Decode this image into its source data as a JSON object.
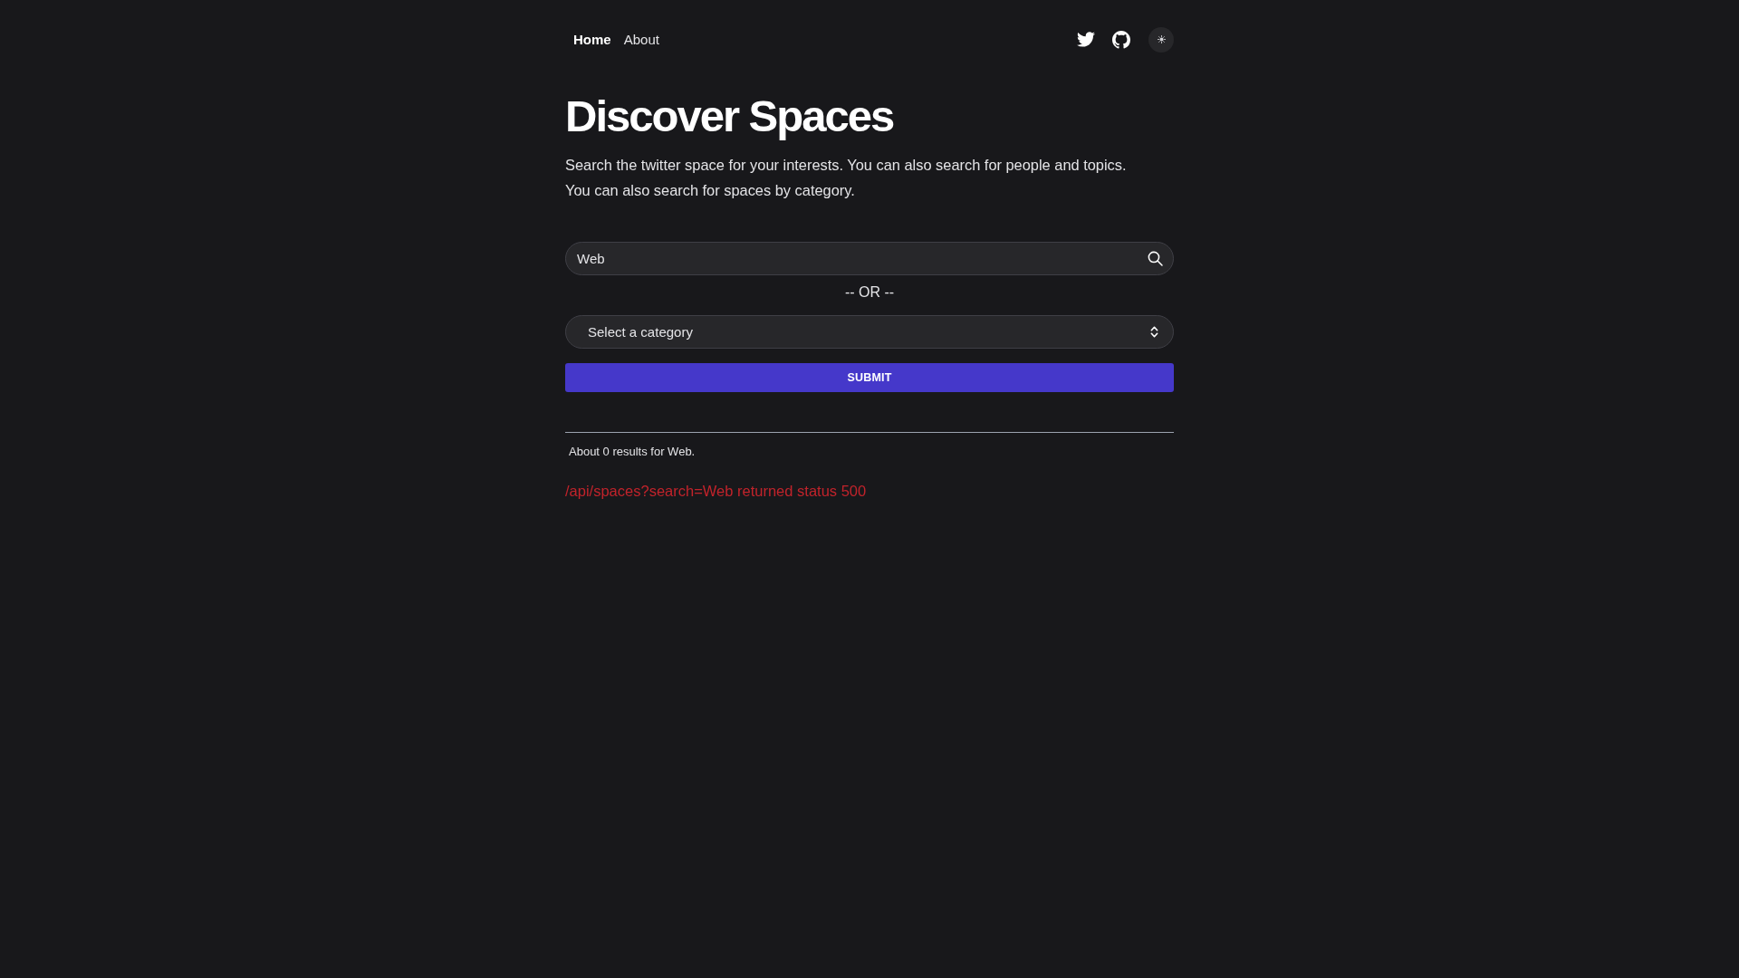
{
  "nav": {
    "links": [
      {
        "label": "Home",
        "selected": true
      },
      {
        "label": "About",
        "selected": false
      }
    ]
  },
  "header": {
    "title": "Discover Spaces",
    "description": "Search the twitter space for your interests. You can also search for people and topics. You can also search for spaces by category."
  },
  "search": {
    "value": "Web"
  },
  "separator": "-- OR --",
  "category_select": {
    "placeholder": "Select a category"
  },
  "submit": {
    "label": "SUBMIT"
  },
  "results": {
    "summary": "About 0 results for Web.",
    "error": "/api/spaces?search=Web returned status 500"
  }
}
